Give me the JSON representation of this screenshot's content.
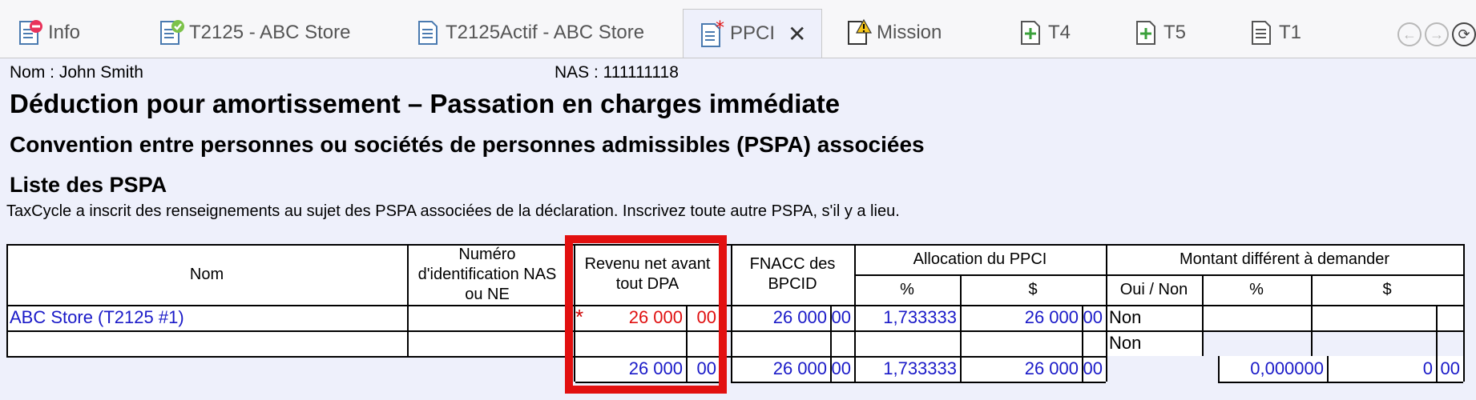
{
  "tabs": [
    {
      "label": "Info",
      "icon": "document-minus-icon"
    },
    {
      "label": "T2125 - ABC Store",
      "icon": "document-check-icon"
    },
    {
      "label": "T2125Actif - ABC Store",
      "icon": "document-icon"
    },
    {
      "label": "PPCI",
      "icon": "document-asterisk-icon",
      "close": "✕"
    },
    {
      "label": "Mission",
      "icon": "document-warning-icon"
    },
    {
      "label": "T4",
      "icon": "document-plus-icon"
    },
    {
      "label": "T5",
      "icon": "document-plus-icon"
    },
    {
      "label": "T1",
      "icon": "document-icon"
    }
  ],
  "header": {
    "name_line": "Nom : John Smith",
    "nas_line": "NAS : 111111118",
    "title": "Déduction pour amortissement – Passation en charges immédiate",
    "subtitle": "Convention entre personnes ou sociétés de personnes admissibles (PSPA) associées",
    "section": "Liste des PSPA",
    "note": "TaxCycle a inscrit des renseignements au sujet des PSPA associées de la déclaration. Inscrivez toute autre PSPA, s'il y a lieu."
  },
  "columns": {
    "nom": "Nom",
    "numero": "Numéro d'identification NAS ou NE",
    "revenu": "Revenu net avant tout DPA",
    "fnacc": "FNACC des BPCID",
    "allocation": "Allocation du PPCI",
    "alloc_pct": "%",
    "alloc_dollar": "$",
    "montant": "Montant différent à demander",
    "oui_non": "Oui / Non",
    "mont_pct": "%",
    "mont_dollar": "$"
  },
  "rows": [
    {
      "nom": "ABC Store (T2125 #1)",
      "revenu_d": "26 000",
      "revenu_c": "00",
      "fnacc_d": "26 000",
      "fnacc_c": "00",
      "pct": "1,733333",
      "alloc_d": "26 000",
      "alloc_c": "00",
      "oui_non": "Non"
    },
    {
      "nom": "",
      "oui_non": "Non"
    }
  ],
  "totals": {
    "revenu_d": "26 000",
    "revenu_c": "00",
    "fnacc_d": "26 000",
    "fnacc_c": "00",
    "pct": "1,733333",
    "alloc_d": "26 000",
    "alloc_c": "00",
    "mont_pct": "0,000000",
    "mont_d": "0",
    "mont_c": "00"
  },
  "colors": {
    "accent_blue": "#1a1ac8",
    "highlight_red": "#e21010",
    "content_bg": "#eef0fb"
  }
}
